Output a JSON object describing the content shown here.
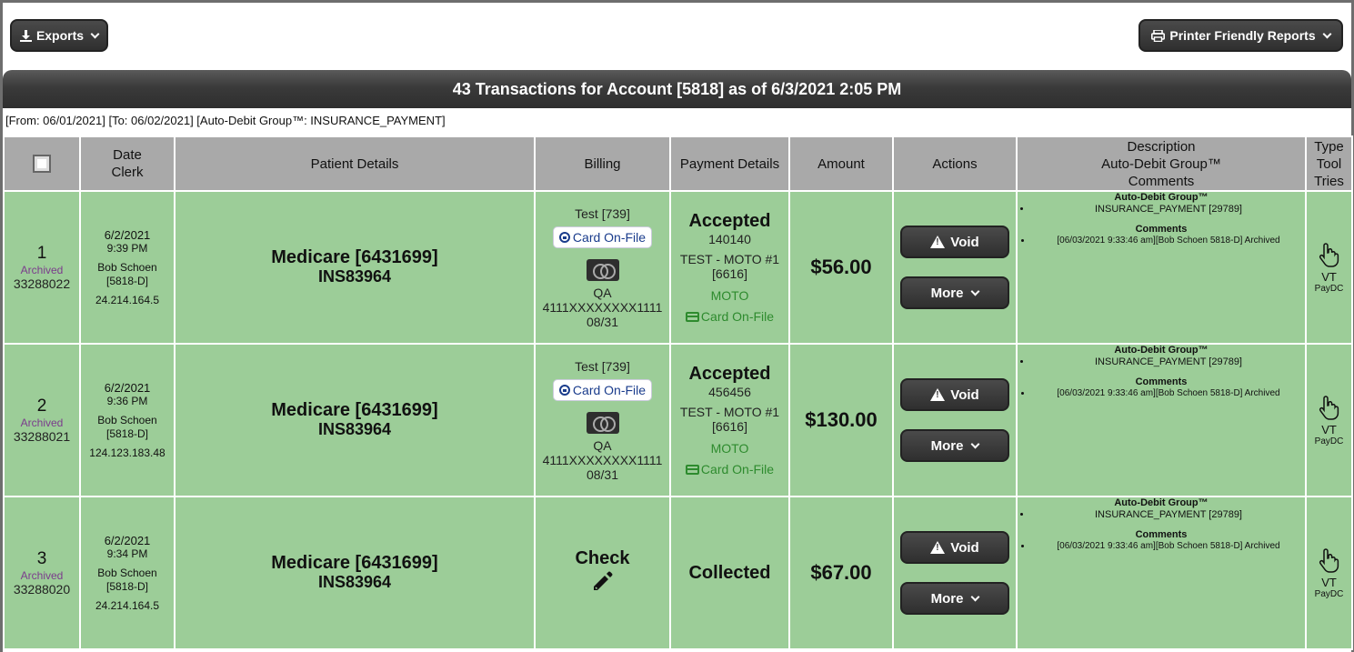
{
  "toolbar": {
    "exports_label": "Exports",
    "printer_label": "Printer Friendly Reports"
  },
  "title": "43 Transactions for Account [5818] as of 6/3/2021 2:05 PM",
  "filter_text": "[From: 06/01/2021] [To: 06/02/2021] [Auto-Debit Group™: INSURANCE_PAYMENT]",
  "headers": {
    "date": "Date",
    "clerk": "Clerk",
    "patient": "Patient Details",
    "billing": "Billing",
    "payment": "Payment Details",
    "amount": "Amount",
    "actions": "Actions",
    "desc1": "Description",
    "desc2": "Auto-Debit Group™",
    "desc3": "Comments",
    "type1": "Type",
    "type2": "Tool",
    "type3": "Tries"
  },
  "rows": [
    {
      "num": "1",
      "status": "Archived",
      "txid": "33288022",
      "date": "6/2/2021",
      "time": "9:39 PM",
      "clerk": "Bob Schoen",
      "clerk_id": "[5818-D]",
      "ip": "24.214.164.5",
      "patient": "Medicare [6431699]",
      "ins": "INS83964",
      "billing_name": "Test [739]",
      "cof_label": "Card On-File",
      "card_name": "QA",
      "card_number": "4111XXXXXXXX1111",
      "card_exp": "08/31",
      "pay_status": "Accepted",
      "auth": "140140",
      "merchant": "TEST - MOTO #1",
      "merchant_id": "[6616]",
      "mode": "MOTO",
      "cof_green": "Card On-File",
      "amount": "$56.00",
      "void_label": "Void",
      "more_label": "More",
      "adg_head": "Auto-Debit Group™",
      "adg_item": "INSURANCE_PAYMENT [29789]",
      "comments_head": "Comments",
      "comment": "[06/03/2021 9:33:46 am][Bob Schoen 5818-D] Archived",
      "type_tool": "VT",
      "type_tries": "PayDC"
    },
    {
      "num": "2",
      "status": "Archived",
      "txid": "33288021",
      "date": "6/2/2021",
      "time": "9:36 PM",
      "clerk": "Bob Schoen",
      "clerk_id": "[5818-D]",
      "ip": "124.123.183.48",
      "patient": "Medicare [6431699]",
      "ins": "INS83964",
      "billing_name": "Test [739]",
      "cof_label": "Card On-File",
      "card_name": "QA",
      "card_number": "4111XXXXXXXX1111",
      "card_exp": "08/31",
      "pay_status": "Accepted",
      "auth": "456456",
      "merchant": "TEST - MOTO #1",
      "merchant_id": "[6616]",
      "mode": "MOTO",
      "cof_green": "Card On-File",
      "amount": "$130.00",
      "void_label": "Void",
      "more_label": "More",
      "adg_head": "Auto-Debit Group™",
      "adg_item": "INSURANCE_PAYMENT [29789]",
      "comments_head": "Comments",
      "comment": "[06/03/2021 9:33:46 am][Bob Schoen 5818-D] Archived",
      "type_tool": "VT",
      "type_tries": "PayDC"
    },
    {
      "num": "3",
      "status": "Archived",
      "txid": "33288020",
      "date": "6/2/2021",
      "time": "9:34 PM",
      "clerk": "Bob Schoen",
      "clerk_id": "[5818-D]",
      "ip": "24.214.164.5",
      "patient": "Medicare [6431699]",
      "ins": "INS83964",
      "billing_check": "Check",
      "pay_status": "Collected",
      "amount": "$67.00",
      "void_label": "Void",
      "more_label": "More",
      "adg_head": "Auto-Debit Group™",
      "adg_item": "INSURANCE_PAYMENT [29789]",
      "comments_head": "Comments",
      "comment": "[06/03/2021 9:33:46 am][Bob Schoen 5818-D] Archived",
      "type_tool": "VT",
      "type_tries": "PayDC"
    }
  ]
}
